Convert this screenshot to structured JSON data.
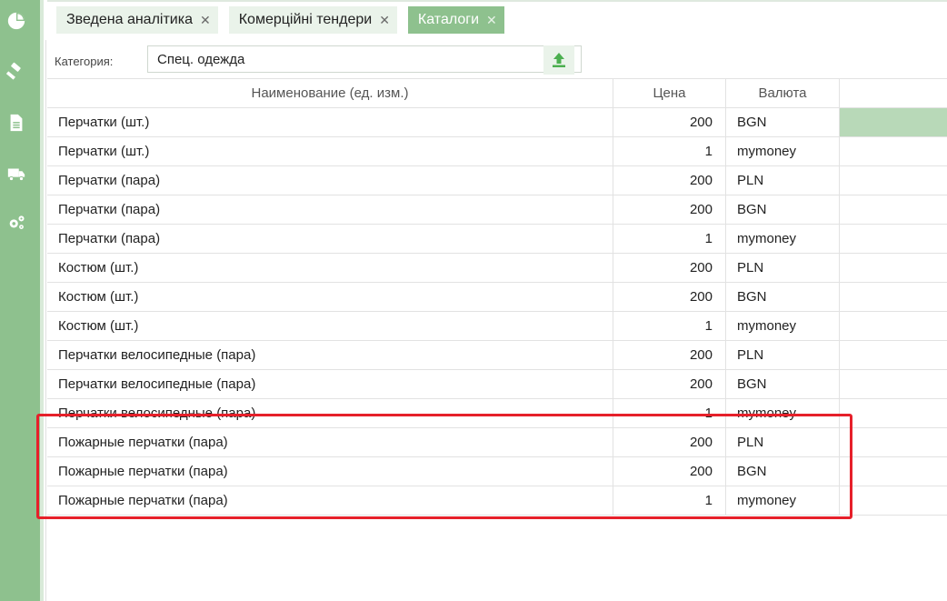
{
  "tabs": [
    {
      "label": "Зведена аналітика",
      "active": false
    },
    {
      "label": "Комерційні тендери",
      "active": false
    },
    {
      "label": "Каталоги",
      "active": true
    }
  ],
  "tab_close_glyph": "✕",
  "sidebar": {
    "icons": [
      "pie-chart-icon",
      "gavel-icon",
      "document-icon",
      "truck-icon",
      "gears-icon"
    ],
    "color": "#8ec18e"
  },
  "category": {
    "label": "Категория:",
    "value": "Спец. одежда"
  },
  "table": {
    "columns": [
      "Наименование (ед. изм.)",
      "Цена",
      "Валюта"
    ],
    "rows": [
      {
        "name": "Перчатки (шт.)",
        "price": "200",
        "currency": "BGN"
      },
      {
        "name": "Перчатки (шт.)",
        "price": "1",
        "currency": "mymoney"
      },
      {
        "name": "Перчатки (пара)",
        "price": "200",
        "currency": "PLN"
      },
      {
        "name": "Перчатки (пара)",
        "price": "200",
        "currency": "BGN"
      },
      {
        "name": "Перчатки (пара)",
        "price": "1",
        "currency": "mymoney"
      },
      {
        "name": "Костюм (шт.)",
        "price": "200",
        "currency": "PLN"
      },
      {
        "name": "Костюм (шт.)",
        "price": "200",
        "currency": "BGN"
      },
      {
        "name": "Костюм (шт.)",
        "price": "1",
        "currency": "mymoney"
      },
      {
        "name": "Перчатки велосипедные (пара)",
        "price": "200",
        "currency": "PLN"
      },
      {
        "name": "Перчатки велосипедные (пара)",
        "price": "200",
        "currency": "BGN"
      },
      {
        "name": "Перчатки велосипедные (пара)",
        "price": "1",
        "currency": "mymoney"
      },
      {
        "name": "Пожарные перчатки (пара)",
        "price": "200",
        "currency": "PLN"
      },
      {
        "name": "Пожарные перчатки (пара)",
        "price": "200",
        "currency": "BGN"
      },
      {
        "name": "Пожарные перчатки (пара)",
        "price": "1",
        "currency": "mymoney"
      }
    ]
  },
  "colors": {
    "accent": "#8ec18e",
    "highlight_border": "#e6202a",
    "selected_row": "#b8d9b8"
  }
}
